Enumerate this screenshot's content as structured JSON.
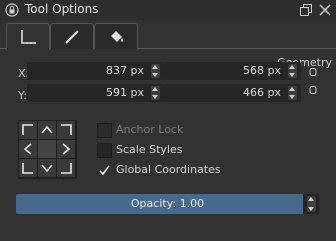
{
  "window": {
    "title": "Tool Options"
  },
  "tabs": [
    {
      "icon": "bounding-box-icon"
    },
    {
      "icon": "line-icon"
    },
    {
      "icon": "paint-bucket-icon"
    }
  ],
  "section_title": "Geometry",
  "position": {
    "x_label": "X:",
    "y_label": "Y:",
    "x_value": "837 px",
    "y_value": "591 px",
    "w_value": "568 px",
    "h_value": "466 px"
  },
  "options": [
    {
      "label": "Anchor Lock",
      "checked": false,
      "enabled": false
    },
    {
      "label": "Scale Styles",
      "checked": false,
      "enabled": true
    },
    {
      "label": "Global Coordinates",
      "checked": true,
      "enabled": true
    }
  ],
  "opacity": {
    "label": "Opacity: 1.00",
    "value": 1.0
  },
  "colors": {
    "accent": "#456a8d",
    "background": "#323232",
    "field": "#262626"
  }
}
